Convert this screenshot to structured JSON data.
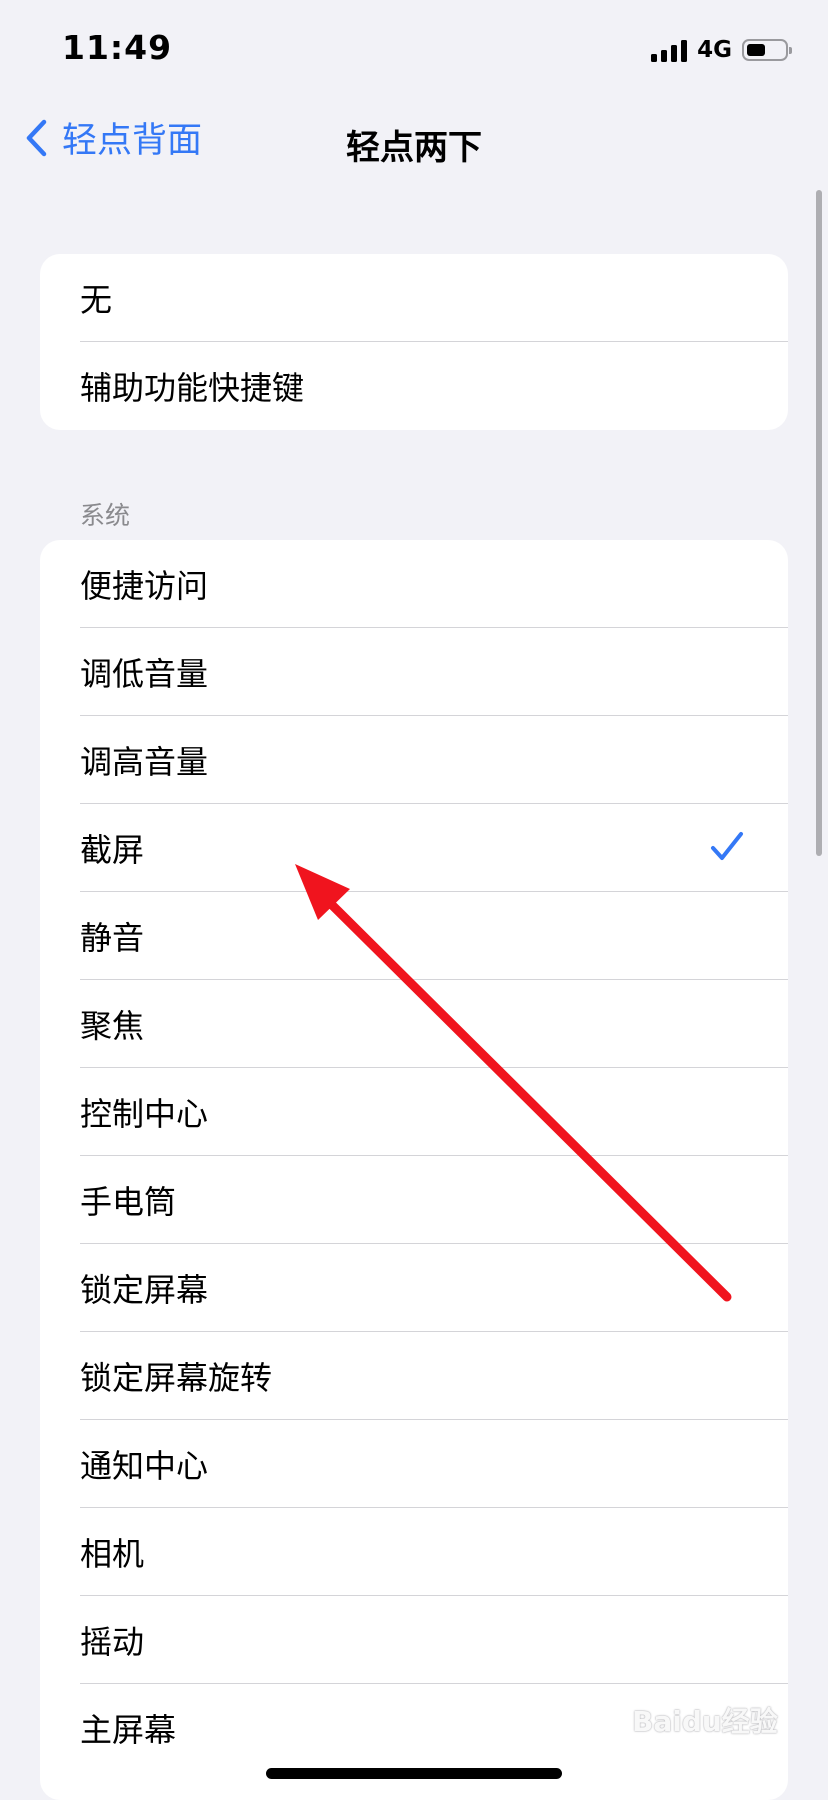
{
  "status_bar": {
    "time": "11:49",
    "network": "4G",
    "battery_level": 0.5
  },
  "nav": {
    "back_label": "轻点背面",
    "title": "轻点两下"
  },
  "top_group": {
    "items": [
      {
        "label": "无"
      },
      {
        "label": "辅助功能快捷键"
      }
    ]
  },
  "system_section": {
    "header": "系统",
    "selected": "截屏",
    "items": [
      {
        "label": "便捷访问"
      },
      {
        "label": "调低音量"
      },
      {
        "label": "调高音量"
      },
      {
        "label": "截屏",
        "checked": true
      },
      {
        "label": "静音"
      },
      {
        "label": "聚焦"
      },
      {
        "label": "控制中心"
      },
      {
        "label": "手电筒"
      },
      {
        "label": "锁定屏幕"
      },
      {
        "label": "锁定屏幕旋转"
      },
      {
        "label": "通知中心"
      },
      {
        "label": "相机"
      },
      {
        "label": "摇动"
      },
      {
        "label": "主屏幕"
      }
    ]
  },
  "colors": {
    "accent": "#3478f6",
    "background": "#f2f2f7",
    "annotation_arrow": "#f0141e"
  },
  "watermark_text": "Baidu经验"
}
